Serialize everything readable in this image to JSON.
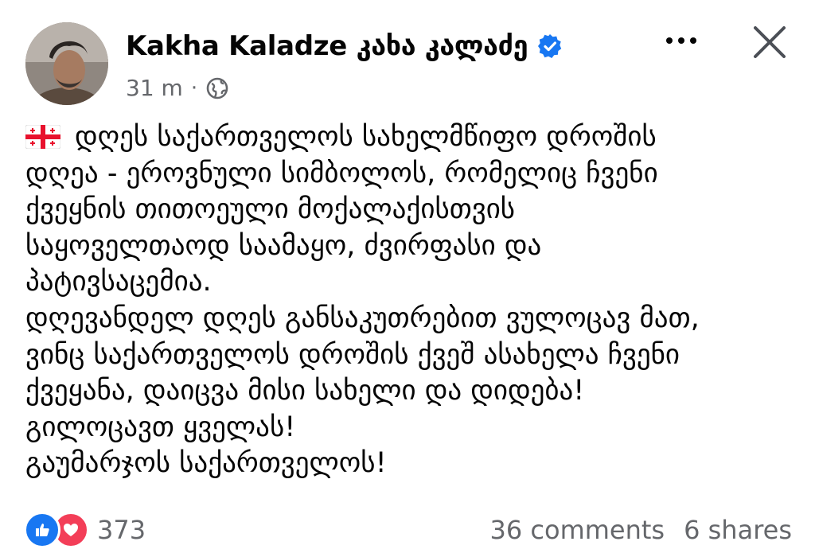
{
  "author": {
    "name": "Kakha Kaladze კახა კალაძე",
    "verified_icon": "verified-badge-icon"
  },
  "meta": {
    "time": "31 m",
    "separator": "·",
    "audience_icon": "globe-icon"
  },
  "header_actions": {
    "more_icon": "more-options-icon",
    "close_icon": "close-icon"
  },
  "post": {
    "flag_icon": "georgia-flag-icon",
    "lines": [
      "დღეს საქართველოს სახელმწიფო დროშის",
      "დღეა - ეროვნული სიმბოლოს, რომელიც ჩვენი",
      "ქვეყნის თითოეული მოქალაქისთვის",
      "საყოველთაოდ საამაყო, ძვირფასი და",
      "პატივსაცემია.",
      "დღევანდელ დღეს განსაკუთრებით ვულოცავ მათ,",
      "ვინც საქართველოს დროშის ქვეშ ასახელა ჩვენი",
      "ქვეყანა, დაიცვა მისი სახელი და დიდება!",
      "გილოცავთ ყველას!",
      "გაუმარჯოს საქართველოს!"
    ]
  },
  "footer": {
    "reaction_icons": [
      "like-icon",
      "love-icon"
    ],
    "reaction_count": "373",
    "comments": "36 comments",
    "shares": "6 shares"
  },
  "colors": {
    "primary_text": "#050505",
    "secondary_text": "#65676b",
    "like_blue": "#1877f2",
    "love_red": "#f33e58",
    "flag_red": "#e8112d"
  }
}
